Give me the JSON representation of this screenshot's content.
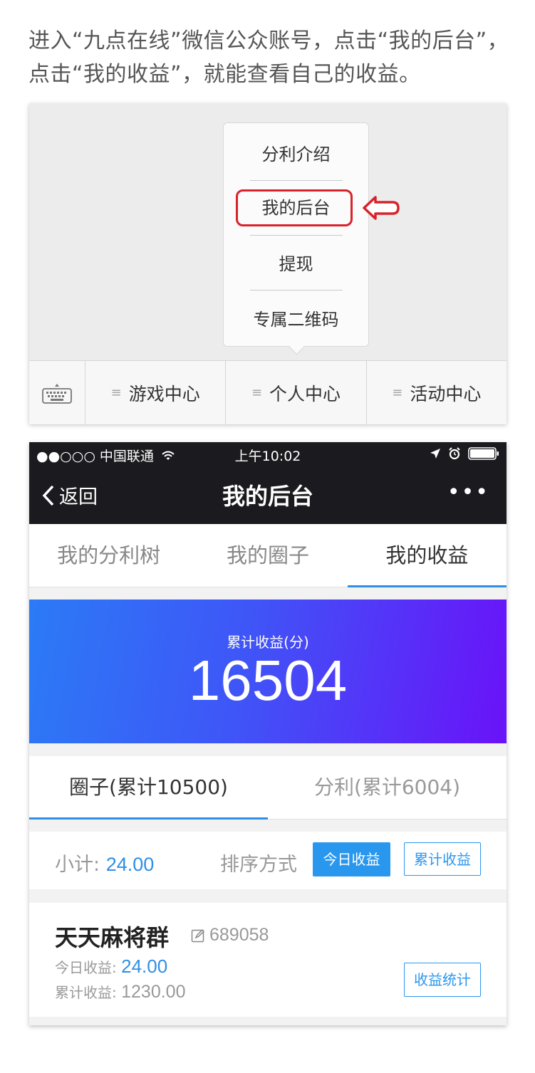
{
  "intro_text": "进入“九点在线”微信公众账号，点击“我的后台”，点击“我的收益”，就能查看自己的收益。",
  "wechat_menu": {
    "popup_items": [
      "分利介绍",
      "我的后台",
      "提现",
      "专属二维码"
    ],
    "highlighted_item": "我的后台",
    "bottom_menu": [
      "游戏中心",
      "个人中心",
      "活动中心"
    ],
    "keyboard_icon": "keyboard-icon",
    "highlight_color": "#d8232a"
  },
  "phone": {
    "status_bar": {
      "carrier": "●●○○○ 中国联通",
      "time": "上午10:02"
    },
    "nav": {
      "back_label": "返回",
      "title": "我的后台",
      "more_label": "•••"
    },
    "tabs": [
      "我的分利树",
      "我的圈子",
      "我的收益"
    ],
    "active_tab": "我的收益",
    "banner": {
      "label": "累计收益(分)",
      "value": "16504",
      "gradient": [
        "#2b7bf6",
        "#6a12f8"
      ]
    },
    "sub_tabs": [
      "圈子(累计10500)",
      "分利(累计6004)"
    ],
    "active_sub_tab": "圈子(累计10500)",
    "subtotal_label": "小计: ",
    "subtotal_value": "24.00",
    "sort_label": "排序方式",
    "sort_today_label": "今日收益",
    "sort_total_label": "累计收益",
    "card": {
      "group_name": "天天麻将群",
      "group_id": "689058",
      "today_label": "今日收益: ",
      "today_value": "24.00",
      "total_label": "累计收益: ",
      "total_value": "1230.00",
      "stats_button": "收益统计"
    },
    "accent_color": "#2f8fe6"
  }
}
